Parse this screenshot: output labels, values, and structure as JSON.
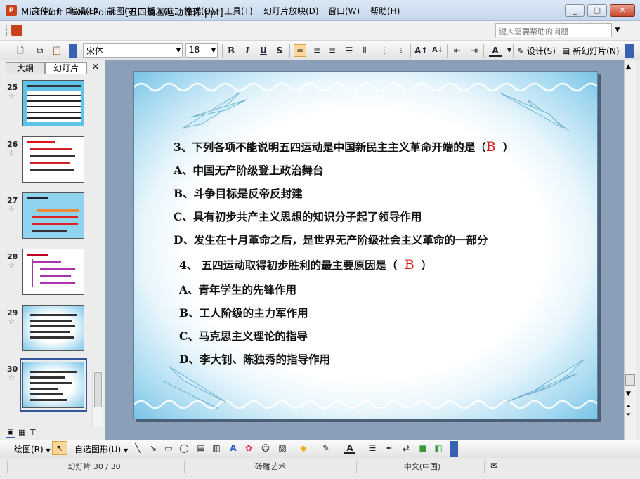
{
  "window": {
    "app_icon": "P",
    "title": "Microsoft PowerPoint - [五四爱国运动课件.ppt]",
    "min": "_",
    "max": "▢",
    "close": "✕"
  },
  "menu": {
    "items": [
      "文件(F)",
      "编辑(E)",
      "视图(V)",
      "插入(I)",
      "格式(O)",
      "工具(T)",
      "幻灯片放映(D)",
      "窗口(W)",
      "帮助(H)"
    ],
    "help_placeholder": "键入需要帮助的问题"
  },
  "format_toolbar": {
    "font": "宋体",
    "size": "18",
    "bold": "B",
    "italic": "I",
    "underline": "U",
    "shadow": "S",
    "font_color": "A",
    "design_label": "设计(S)",
    "new_slide_label": "新幻灯片(N)"
  },
  "left_pane": {
    "tabs": [
      "大纲",
      "幻灯片"
    ],
    "close": "×",
    "slides": [
      {
        "num": "25",
        "star": "☆"
      },
      {
        "num": "26",
        "star": "☆"
      },
      {
        "num": "27",
        "star": "☆"
      },
      {
        "num": "28",
        "star": "☆"
      },
      {
        "num": "29",
        "star": "☆"
      },
      {
        "num": "30",
        "star": "☆"
      }
    ]
  },
  "slide": {
    "q3": "3、下列各项不能说明五四运动是中国新民主主义革命开端的是（",
    "q3_answer": "B",
    "q3_close": "）",
    "q3_options": [
      "A、中国无产阶级登上政治舞台",
      "B、斗争目标是反帝反封建",
      "C、具有初步共产主义思想的知识分子起了领导作用",
      "D、发生在十月革命之后，是世界无产阶级社会主义革命的一部分"
    ],
    "q4": "4、 五四运动取得初步胜利的最主要原因是（",
    "q4_answer": "B",
    "q4_close": "）",
    "q4_options": [
      "A、青年学生的先锋作用",
      "B、工人阶级的主力军作用",
      "C、马克思主义理论的指导",
      "D、李大钊、陈独秀的指导作用"
    ]
  },
  "drawing_toolbar": {
    "draw_label": "绘图(R)",
    "autoshapes_label": "自选图形(U)"
  },
  "status": {
    "slide_pos": "幻灯片 30 / 30",
    "design": "砖雕艺术",
    "language": "中文(中国)"
  }
}
